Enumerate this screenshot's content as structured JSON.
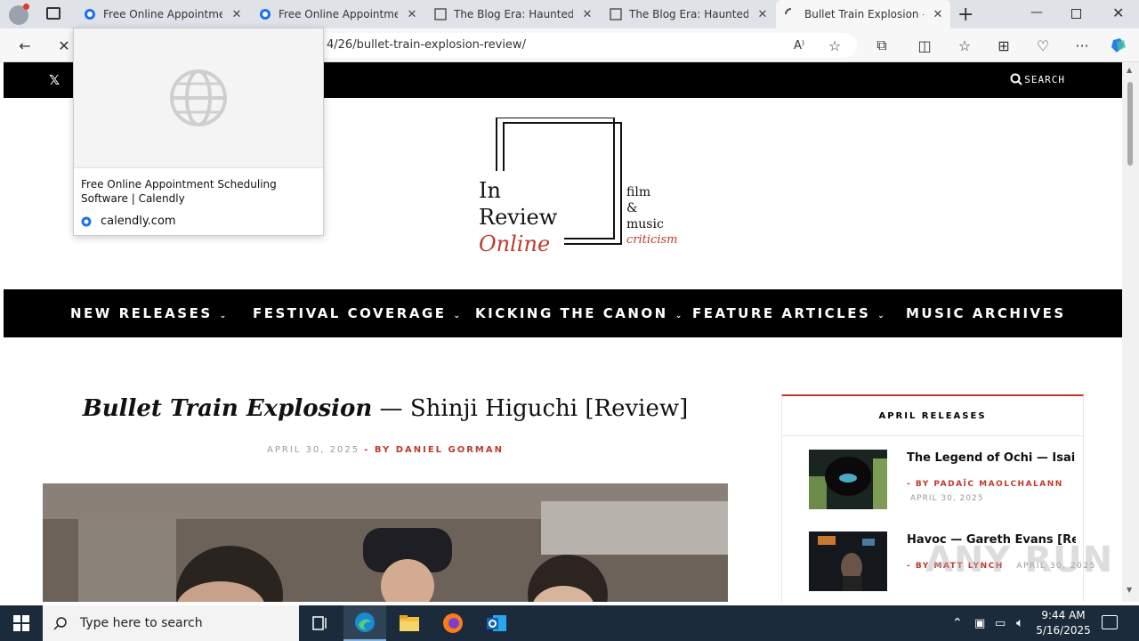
{
  "browser": {
    "tabs": [
      {
        "title": "Free Online Appointment",
        "favicon": "calendly-icon"
      },
      {
        "title": "Free Online Appointment",
        "favicon": "calendly-icon"
      },
      {
        "title": "The Blog Era: Haunted H",
        "favicon": "page-icon"
      },
      {
        "title": "The Blog Era: Haunted H",
        "favicon": "page-icon"
      },
      {
        "title": "Bullet Train Explosion —",
        "favicon": "loading-icon"
      }
    ],
    "url": "4/26/bullet-train-explosion-review/",
    "tooltip": {
      "title": "Free Online Appointment Scheduling Software | Calendly",
      "domain": "calendly.com"
    }
  },
  "site": {
    "search_label": "SEARCH",
    "logo": {
      "line1": "In",
      "line2": "Review",
      "line3": "Online",
      "tag1": "film",
      "tag2": "&",
      "tag3": "music",
      "tag4": "criticism"
    },
    "nav": [
      {
        "label": "NEW RELEASES",
        "chevron": true
      },
      {
        "label": "FESTIVAL COVERAGE",
        "chevron": true
      },
      {
        "label": "KICKING THE CANON",
        "chevron": true
      },
      {
        "label": "FEATURE ARTICLES",
        "chevron": true
      },
      {
        "label": "MUSIC ARCHIVES",
        "chevron": false
      }
    ],
    "article": {
      "title_italic": "Bullet Train Explosion",
      "title_rest": " — Shinji Higuchi [Review]",
      "date": "APRIL 30, 2025",
      "byline": "- BY DANIEL GORMAN"
    },
    "sidebar": {
      "heading": "APRIL RELEASES",
      "items": [
        {
          "title": "The Legend of Ochi — Isai...",
          "by": "- BY PADAÏC MAOLCHALANN",
          "date": "APRIL 30, 2025"
        },
        {
          "title": "Havoc — Gareth Evans [Re...",
          "by": "- BY MATT LYNCH",
          "date": "APRIL 30, 2025"
        }
      ]
    }
  },
  "taskbar": {
    "search_placeholder": "Type here to search",
    "time": "9:44 AM",
    "date": "5/16/2025"
  },
  "watermark": "ANY RUN"
}
